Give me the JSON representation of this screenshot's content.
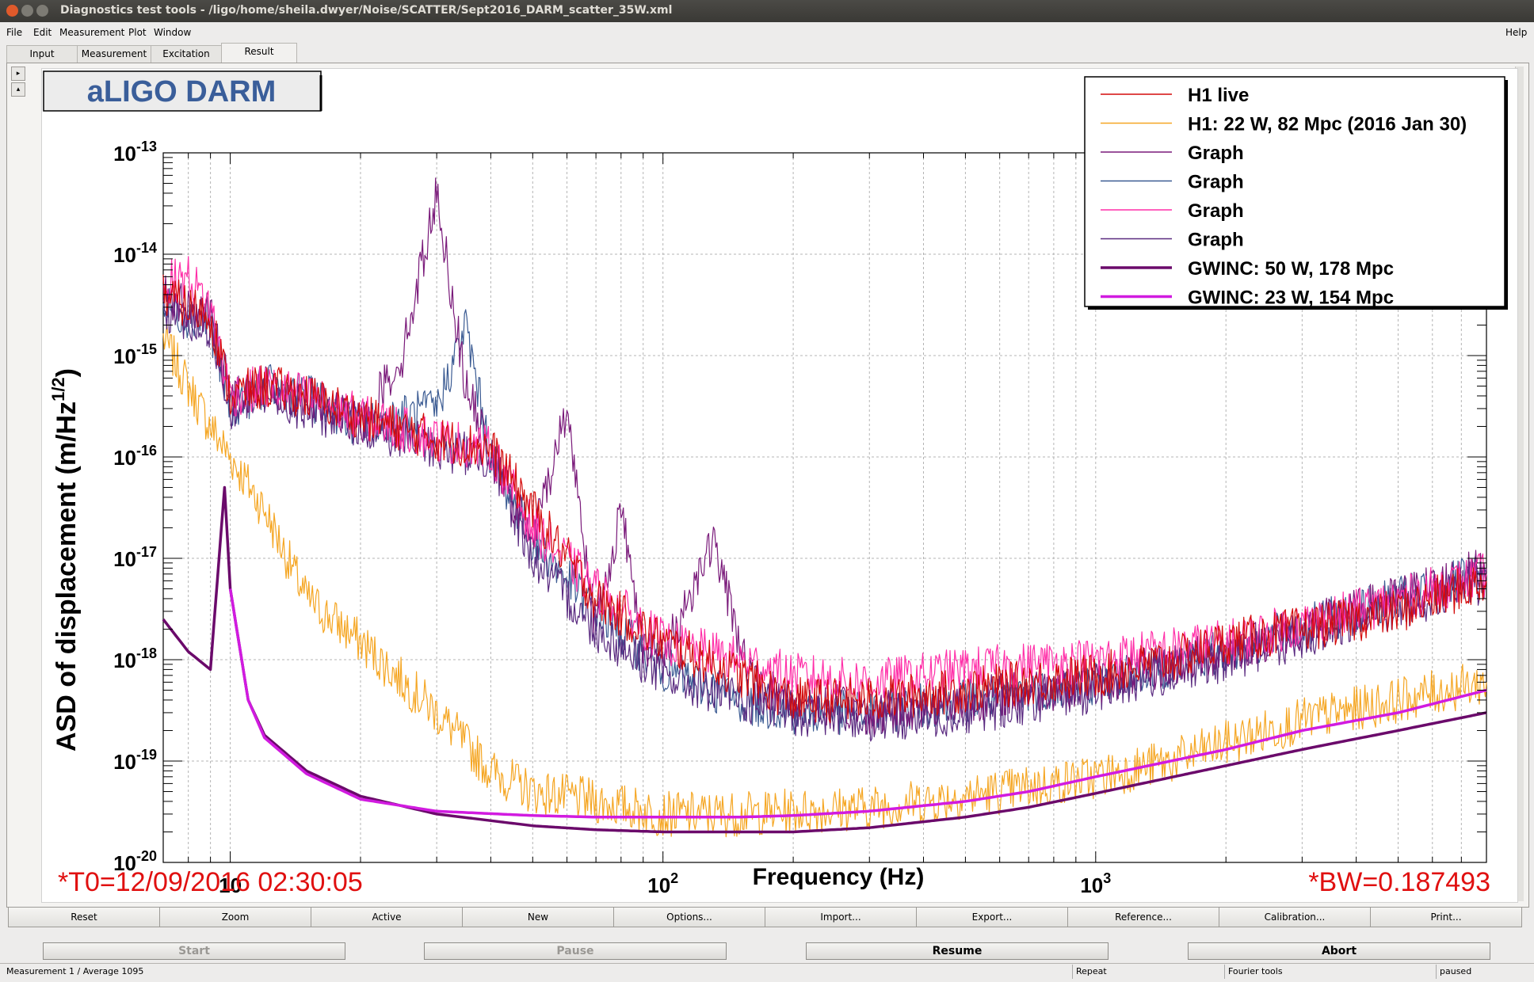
{
  "window": {
    "title": "Diagnostics test tools - /ligo/home/sheila.dwyer/Noise/SCATTER/Sept2016_DARM_scatter_35W.xml"
  },
  "menu": {
    "file": "File",
    "edit": "Edit",
    "measurement": "Measurement",
    "plot": "Plot",
    "window": "Window",
    "help": "Help"
  },
  "tabs": {
    "input": "Input",
    "measurement": "Measurement",
    "excitation": "Excitation",
    "result": "Result"
  },
  "plot": {
    "title": "aLIGO DARM",
    "t0_label": "*T0=12/09/2016 02:30:05",
    "bw_label": "*BW=0.187493",
    "legend": [
      {
        "label": "H1 live",
        "color": "#d40a0a",
        "width": 1.5
      },
      {
        "label": "H1: 22 W, 82 Mpc (2016 Jan 30)",
        "color": "#f5a623",
        "width": 1.5
      },
      {
        "label": "Graph",
        "color": "#7a1a7a",
        "width": 1.5
      },
      {
        "label": "Graph",
        "color": "#3b5b93",
        "width": 1.5
      },
      {
        "label": "Graph",
        "color": "#ff2fa8",
        "width": 1.5
      },
      {
        "label": "Graph",
        "color": "#5a2a80",
        "width": 1.5
      },
      {
        "label": "GWINC: 50 W, 178 Mpc",
        "color": "#6b0a6b",
        "width": 3.5
      },
      {
        "label": "GWINC: 23 W, 154 Mpc",
        "color": "#d11be0",
        "width": 3.5
      }
    ]
  },
  "chart_data": {
    "type": "line",
    "xlabel": "Frequency (Hz)",
    "ylabel": "ASD of displacement (m/Hz^(1/2))",
    "x_scale": "log",
    "y_scale": "log",
    "xlim": [
      7,
      8000
    ],
    "ylim": [
      1e-20,
      1e-13
    ],
    "x_ticks": [
      "10",
      "10^2",
      "10^3"
    ],
    "y_ticks": [
      "10^-13",
      "10^-14",
      "10^-15",
      "10^-16",
      "10^-17",
      "10^-18",
      "10^-19",
      "10^-20"
    ],
    "grid": true,
    "legend_position": "top-right",
    "series": [
      {
        "name": "H1 live",
        "color": "#d40a0a",
        "x": [
          7,
          8,
          9,
          10,
          12,
          15,
          20,
          30,
          40,
          50,
          70,
          100,
          150,
          200,
          300,
          500,
          700,
          1000,
          1500,
          2000,
          3000,
          5000,
          8000
        ],
        "y": [
          4e-15,
          3e-15,
          2.5e-15,
          4e-16,
          5e-16,
          4e-16,
          2.5e-16,
          1.5e-16,
          1.2e-16,
          3e-17,
          4e-18,
          1.5e-18,
          7e-19,
          4e-19,
          4e-19,
          5e-19,
          6e-19,
          7e-19,
          1e-18,
          1.5e-18,
          2e-18,
          3e-18,
          6e-18
        ]
      },
      {
        "name": "H1: 22 W, 82 Mpc (2016 Jan 30)",
        "color": "#f5a623",
        "x": [
          7,
          8,
          9,
          10,
          12,
          15,
          20,
          30,
          40,
          50,
          70,
          100,
          150,
          200,
          300,
          500,
          700,
          1000,
          1500,
          2000,
          3000,
          5000,
          8000
        ],
        "y": [
          1.5e-15,
          5e-16,
          2e-16,
          1e-16,
          3e-17,
          4e-18,
          1.5e-18,
          3e-19,
          8e-20,
          5e-20,
          4e-20,
          3e-20,
          3e-20,
          3.2e-20,
          3.5e-20,
          4.5e-20,
          5.5e-20,
          7e-20,
          1e-19,
          1.5e-19,
          2.5e-19,
          4e-19,
          6e-19
        ]
      },
      {
        "name": "Graph",
        "color": "#7a1a7a",
        "x": [
          7,
          8,
          9,
          10,
          12,
          15,
          20,
          25,
          30,
          35,
          40,
          50,
          60,
          70,
          80,
          90,
          100,
          130,
          160,
          200,
          300,
          500,
          1000,
          2000,
          4000,
          8000
        ],
        "y": [
          4e-15,
          3e-15,
          2.5e-15,
          4e-16,
          5e-16,
          4e-16,
          2e-16,
          1e-15,
          4e-14,
          5e-16,
          1e-16,
          1.5e-17,
          3e-16,
          2e-18,
          3e-17,
          1.5e-18,
          1e-18,
          1.5e-17,
          6e-19,
          4e-19,
          3e-19,
          4e-19,
          6e-19,
          1.2e-18,
          3e-18,
          8e-18
        ]
      },
      {
        "name": "Graph",
        "color": "#3b5b93",
        "x": [
          7,
          8,
          9,
          10,
          12,
          15,
          20,
          30,
          35,
          40,
          50,
          70,
          100,
          150,
          200,
          300,
          500,
          1000,
          2000,
          4000,
          8000
        ],
        "y": [
          3e-15,
          2.5e-15,
          2e-15,
          3e-16,
          5e-16,
          4e-16,
          2e-16,
          3e-16,
          2e-15,
          1e-16,
          1.5e-17,
          3e-18,
          8e-19,
          4e-19,
          3e-19,
          3e-19,
          4e-19,
          6e-19,
          1.2e-18,
          3e-18,
          7e-18
        ]
      },
      {
        "name": "Graph",
        "color": "#ff2fa8",
        "x": [
          7,
          8,
          9,
          10,
          12,
          15,
          20,
          30,
          40,
          50,
          70,
          100,
          150,
          200,
          300,
          500,
          1000,
          2000,
          4000,
          8000
        ],
        "y": [
          5e-15,
          6e-15,
          3e-15,
          4e-16,
          5e-16,
          4e-16,
          2.5e-16,
          1.5e-16,
          1.2e-16,
          2e-17,
          5e-18,
          1.5e-18,
          1e-18,
          7e-19,
          6e-19,
          8e-19,
          1e-18,
          1.5e-18,
          3e-18,
          7e-18
        ]
      },
      {
        "name": "Graph",
        "color": "#5a2a80",
        "x": [
          7,
          8,
          9,
          10,
          12,
          15,
          20,
          30,
          40,
          50,
          70,
          100,
          150,
          200,
          300,
          500,
          1000,
          2000,
          4000,
          8000
        ],
        "y": [
          3e-15,
          2e-15,
          2e-15,
          3e-16,
          4e-16,
          3e-16,
          2e-16,
          1.2e-16,
          1e-16,
          1e-17,
          2e-18,
          7e-19,
          4e-19,
          3e-19,
          2.5e-19,
          3e-19,
          5e-19,
          1e-18,
          2.5e-18,
          6e-18
        ]
      },
      {
        "name": "GWINC: 50 W, 178 Mpc",
        "color": "#6b0a6b",
        "x": [
          7,
          8,
          9,
          9.7,
          10,
          11,
          12,
          15,
          20,
          30,
          50,
          70,
          100,
          150,
          200,
          300,
          500,
          700,
          1000,
          2000,
          3000,
          5000,
          8000
        ],
        "y": [
          2.5e-18,
          1.2e-18,
          8e-19,
          5e-17,
          5e-18,
          4e-19,
          1.8e-19,
          8e-20,
          4.5e-20,
          3e-20,
          2.3e-20,
          2.1e-20,
          2e-20,
          2e-20,
          2e-20,
          2.2e-20,
          2.8e-20,
          3.5e-20,
          4.8e-20,
          9e-20,
          1.3e-19,
          2e-19,
          3e-19
        ]
      },
      {
        "name": "GWINC: 23 W, 154 Mpc",
        "color": "#d11be0",
        "x": [
          10,
          11,
          12,
          15,
          20,
          30,
          50,
          70,
          100,
          150,
          200,
          300,
          500,
          700,
          1000,
          2000,
          3000,
          5000,
          8000
        ],
        "y": [
          5e-18,
          4e-19,
          1.7e-19,
          7.5e-20,
          4.2e-20,
          3.2e-20,
          2.9e-20,
          2.8e-20,
          2.8e-20,
          2.8e-20,
          2.9e-20,
          3.2e-20,
          4e-20,
          5e-20,
          7e-20,
          1.3e-19,
          2e-19,
          3e-19,
          5e-19
        ]
      }
    ]
  },
  "buttons_row1": [
    "Reset",
    "Zoom",
    "Active",
    "New",
    "Options...",
    "Import...",
    "Export...",
    "Reference...",
    "Calibration...",
    "Print..."
  ],
  "buttons_row2": {
    "start": "Start",
    "pause": "Pause",
    "resume": "Resume",
    "abort": "Abort"
  },
  "status": {
    "measurement": "Measurement 1 / Average 1095",
    "repeat": "Repeat",
    "fourier": "Fourier tools",
    "state": "paused"
  }
}
